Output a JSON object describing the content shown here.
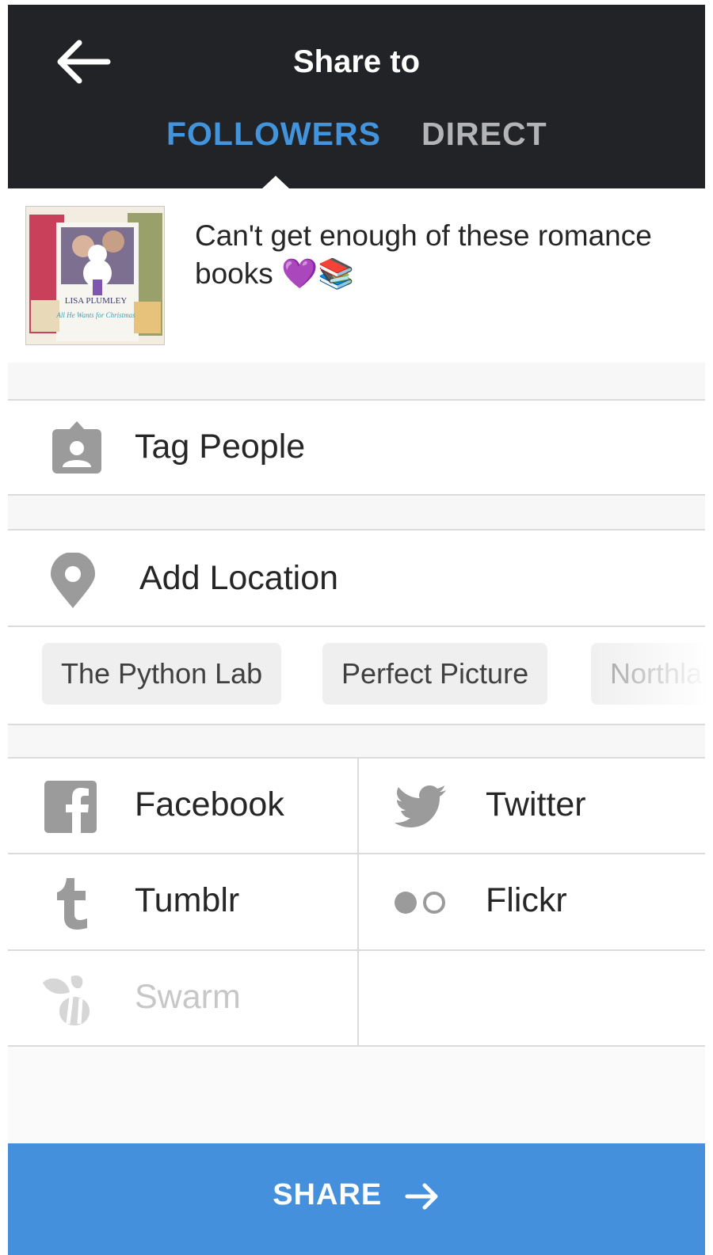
{
  "header": {
    "title": "Share to",
    "tabs": [
      {
        "label": "FOLLOWERS",
        "active": true
      },
      {
        "label": "DIRECT",
        "active": false
      }
    ]
  },
  "caption": {
    "text": "Can't get enough of these romance books 💜📚",
    "thumbnail_label": "LISA PLUMLEY",
    "thumbnail_subtitle": "All He Wants for Christmas"
  },
  "options": {
    "tag_people": "Tag People",
    "add_location": "Add Location"
  },
  "location_suggestions": [
    "The Python Lab",
    "Perfect Picture",
    "Northla"
  ],
  "share_targets": [
    {
      "label": "Facebook",
      "icon": "facebook-icon"
    },
    {
      "label": "Twitter",
      "icon": "twitter-icon"
    },
    {
      "label": "Tumblr",
      "icon": "tumblr-icon"
    },
    {
      "label": "Flickr",
      "icon": "flickr-icon"
    },
    {
      "label": "Swarm",
      "icon": "swarm-icon",
      "disabled": true
    }
  ],
  "share_button": "SHARE",
  "colors": {
    "header_bg": "#222326",
    "active_tab": "#4294dd",
    "inactive_tab": "#b4b4b6",
    "share_bar": "#4490dc",
    "icon_gray": "#9b9b9b",
    "disabled_text": "#c7c7c7"
  }
}
